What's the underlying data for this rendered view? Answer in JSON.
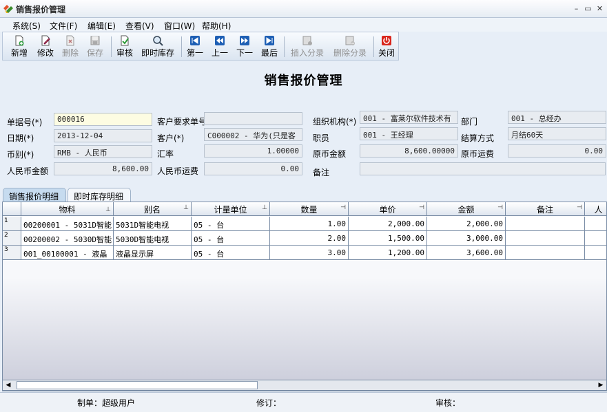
{
  "window": {
    "title": "销售报价管理"
  },
  "menu": [
    "系统(S)",
    "文件(F)",
    "编辑(E)",
    "查看(V)",
    "窗口(W)",
    "帮助(H)"
  ],
  "toolbar": [
    {
      "label": "新增",
      "icon": "new-doc-icon",
      "enabled": true
    },
    {
      "label": "修改",
      "icon": "edit-icon",
      "enabled": true
    },
    {
      "label": "删除",
      "icon": "delete-icon",
      "enabled": false
    },
    {
      "label": "保存",
      "icon": "save-icon",
      "enabled": false
    },
    {
      "label": "审核",
      "icon": "approve-icon",
      "enabled": true
    },
    {
      "label": "即时库存",
      "icon": "inventory-search-icon",
      "enabled": true
    },
    {
      "label": "第一",
      "icon": "first-record-icon",
      "enabled": true
    },
    {
      "label": "上一",
      "icon": "previous-record-icon",
      "enabled": true
    },
    {
      "label": "下一",
      "icon": "next-record-icon",
      "enabled": true
    },
    {
      "label": "最后",
      "icon": "last-record-icon",
      "enabled": true
    },
    {
      "label": "插入分录",
      "icon": "insert-row-icon",
      "enabled": false
    },
    {
      "label": "删除分录",
      "icon": "delete-row-icon",
      "enabled": false
    },
    {
      "label": "关闭",
      "icon": "power-icon",
      "enabled": true
    }
  ],
  "form": {
    "heading": "销售报价管理",
    "doc_no_label": "单据号(*)",
    "doc_no": "000016",
    "date_label": "日期(*)",
    "date": "2013-12-04",
    "currency_label": "币别(*)",
    "currency": "RMB - 人民币",
    "rmb_amount_label": "人民币金额",
    "rmb_amount": "8,600.00",
    "customer_req_no_label": "客户要求单号",
    "customer_req_no": "",
    "customer_label": "客户(*)",
    "customer": "C000002 - 华为(只是客",
    "rate_label": "汇率",
    "rate": "1.00000",
    "rmb_freight_label": "人民币运费",
    "rmb_freight": "0.00",
    "org_label": "组织机构(*)",
    "org": "001 - 富莱尔软件技术有",
    "staff_label": "职员",
    "staff": "001 - 王经理",
    "orig_amount_label": "原币金额",
    "orig_amount": "8,600.00000",
    "remark_label": "备注",
    "remark": "",
    "dept_label": "部门",
    "dept": "001 - 总经办",
    "settle_label": "结算方式",
    "settle": "月结60天",
    "orig_freight_label": "原币运费",
    "orig_freight": "0.00"
  },
  "tabs": [
    "销售报价明细",
    "即时库存明细"
  ],
  "grid": {
    "columns": [
      "物料",
      "别名",
      "计量单位",
      "数量",
      "单价",
      "金额",
      "备注",
      "人"
    ],
    "rows": [
      {
        "no": "1",
        "item": "00200001 - 5031D智能",
        "alias": "5031D智能电视",
        "unit": "05 - 台",
        "qty": "1.00",
        "price": "2,000.00",
        "amount": "2,000.00",
        "remark": ""
      },
      {
        "no": "2",
        "item": "00200002 - 5030D智能",
        "alias": "5030D智能电视",
        "unit": "05 - 台",
        "qty": "2.00",
        "price": "1,500.00",
        "amount": "3,000.00",
        "remark": ""
      },
      {
        "no": "3",
        "item": "001_00100001 - 液晶",
        "alias": "液晶显示屏",
        "unit": "05 - 台",
        "qty": "3.00",
        "price": "1,200.00",
        "amount": "3,600.00",
        "remark": ""
      }
    ]
  },
  "footer": {
    "maker": "制单：超级用户",
    "modifier": "修订：",
    "approver": "审核："
  },
  "colors": {
    "highlight_field": "#fdfce2",
    "active_tab": "#c6dbef",
    "close_button": "#d9261c"
  }
}
